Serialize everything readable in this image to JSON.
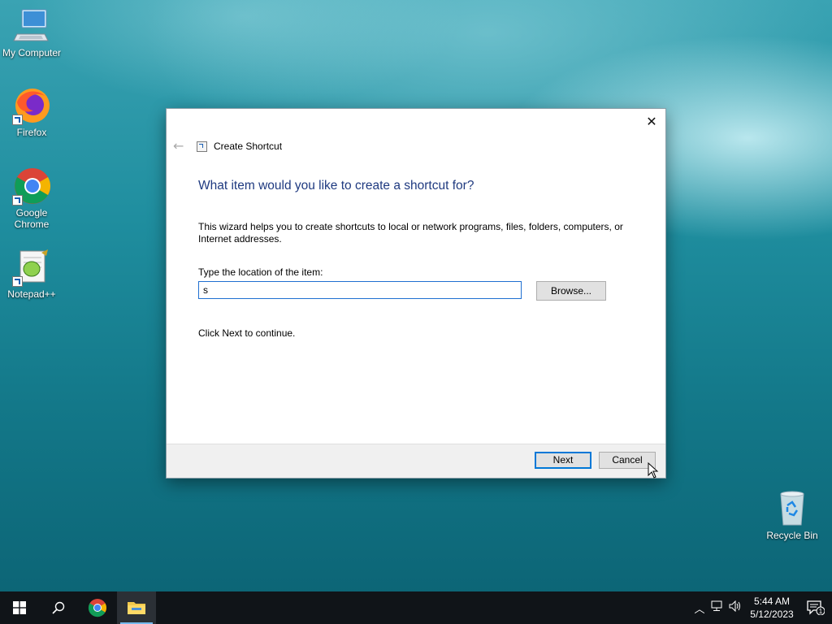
{
  "desktop": {
    "icons": [
      {
        "label": "My Computer",
        "icon": "computer-icon"
      },
      {
        "label": "Firefox",
        "icon": "firefox-icon"
      },
      {
        "label": "Google Chrome",
        "icon": "chrome-icon"
      },
      {
        "label": "Notepad++",
        "icon": "notepadpp-icon"
      },
      {
        "label": "Recycle Bin",
        "icon": "recycle-bin-icon"
      }
    ]
  },
  "dialog": {
    "title": "Create Shortcut",
    "heading": "What item would you like to create a shortcut for?",
    "description": "This wizard helps you to create shortcuts to local or network programs, files, folders, computers, or Internet addresses.",
    "location_label": "Type the location of the item:",
    "location_value": "s",
    "browse_label": "Browse...",
    "continue_text": "Click Next to continue.",
    "next_label": "Next",
    "cancel_label": "Cancel"
  },
  "taskbar": {
    "time": "5:44 AM",
    "date": "5/12/2023",
    "notification_count": "1",
    "accent": "#76b9ed"
  }
}
